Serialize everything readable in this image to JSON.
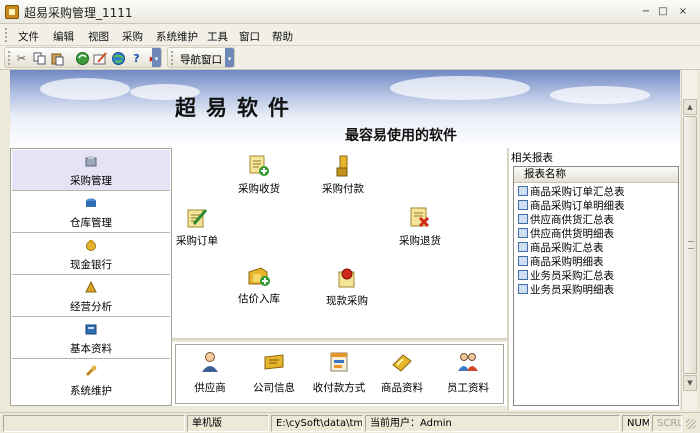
{
  "window": {
    "title": "超易采购管理_1111",
    "controls": {
      "minimize": "−",
      "maximize": "□",
      "close": "×"
    }
  },
  "menu": {
    "items": [
      "文件",
      "编辑",
      "视图",
      "采购",
      "系统维护",
      "工具",
      "窗口",
      "帮助"
    ]
  },
  "toolbar": {
    "icons": [
      "cut-icon",
      "copy-icon",
      "paste-icon",
      "refresh-icon",
      "edit-icon",
      "globe-icon",
      "help-icon"
    ],
    "nav_window_label": "导航窗口"
  },
  "banner": {
    "title": "超易软件",
    "subtitle": "最容易使用的软件"
  },
  "nav": {
    "items": [
      {
        "label": "采购管理",
        "icon": "purchase-icon",
        "selected": true
      },
      {
        "label": "仓库管理",
        "icon": "warehouse-icon",
        "selected": false
      },
      {
        "label": "现金银行",
        "icon": "cash-icon",
        "selected": false
      },
      {
        "label": "经营分析",
        "icon": "analysis-icon",
        "selected": false
      },
      {
        "label": "基本资料",
        "icon": "basic-data-icon",
        "selected": false
      },
      {
        "label": "系统维护",
        "icon": "maintenance-icon",
        "selected": false
      }
    ]
  },
  "functions": {
    "items": [
      {
        "label": "采购收货",
        "icon": "receipt-icon"
      },
      {
        "label": "采购付款",
        "icon": "payment-icon"
      },
      {
        "label": "采购订单",
        "icon": "order-icon"
      },
      {
        "label": "采购退货",
        "icon": "return-icon"
      },
      {
        "label": "估价入库",
        "icon": "estimate-icon"
      },
      {
        "label": "现款采购",
        "icon": "cash-purchase-icon"
      }
    ]
  },
  "lower_functions": {
    "items": [
      {
        "label": "供应商",
        "icon": "supplier-icon"
      },
      {
        "label": "公司信息",
        "icon": "company-icon"
      },
      {
        "label": "收付款方式",
        "icon": "payment-method-icon"
      },
      {
        "label": "商品资料",
        "icon": "product-icon"
      },
      {
        "label": "员工资料",
        "icon": "staff-icon"
      }
    ]
  },
  "reports": {
    "heading": "相关报表",
    "column_header": "报表名称",
    "items": [
      "商品采购订单汇总表",
      "商品采购订单明细表",
      "供应商供货汇总表",
      "供应商供货明细表",
      "商品采购汇总表",
      "商品采购明细表",
      "业务员采购汇总表",
      "业务员采购明细表"
    ]
  },
  "statusbar": {
    "mode": "单机版",
    "path": "E:\\cySoft\\data\\tmpcyjxc.sys",
    "user": "当前用户：Admin",
    "num": "NUM",
    "scrl": "SCRL"
  },
  "colors": {
    "nav_selected": "#e6e3f6",
    "banner_top": "#6f89c4",
    "toolbar_chevron": "#6d87b7"
  }
}
